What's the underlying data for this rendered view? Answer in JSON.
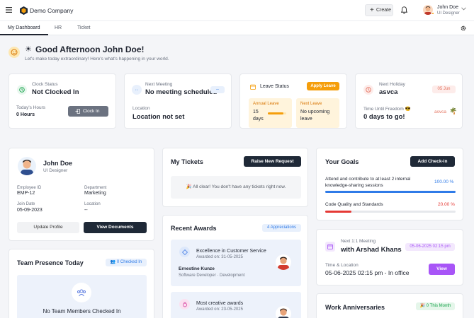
{
  "header": {
    "company_name": "Demo Company",
    "create_label": "Create",
    "user_name": "John Doe",
    "user_role": "UI Designer"
  },
  "tabs": [
    "My Dashboard",
    "HR",
    "Ticket"
  ],
  "greeting": {
    "title": "Good Afternoon John Doe!",
    "subtitle": "Let's make today extraordinary! Here's what's happening in your world."
  },
  "clock": {
    "label": "Clock Status",
    "status": "Not Clocked In",
    "hours_label": "Today's Hours",
    "hours_value": "0 Hours",
    "button": "Clock In"
  },
  "meeting": {
    "label": "Next Meeting",
    "value": "No meeting scheduled",
    "badge": "--",
    "location_label": "Location",
    "location_value": "Location not set"
  },
  "leave": {
    "title": "Leave Status",
    "button": "Apply Leave",
    "annual_label": "Annual Leave",
    "annual_value": "15 days",
    "annual_progress": 0.85,
    "next_label": "Next Leave",
    "next_value": "No upcoming leave"
  },
  "holiday": {
    "label": "Next Holiday",
    "name": "asvca",
    "date": "05 Jun",
    "freedom_label": "Time Until Freedom 😎",
    "freedom_value": "0 days to go!",
    "tag": "asvca"
  },
  "profile": {
    "name": "John Doe",
    "role": "UI Designer",
    "employee_id_label": "Employee ID",
    "employee_id": "EMP-12",
    "department_label": "Department",
    "department": "Marketing",
    "join_label": "Join Date",
    "join_date": "05-09-2023",
    "location_label": "Location",
    "location": "--",
    "update_button": "Update Profile",
    "documents_button": "View Documents"
  },
  "presence": {
    "title": "Team Presence Today",
    "badge": "0 Checked In",
    "empty": "No Team Members Checked In"
  },
  "tickets": {
    "title": "My Tickets",
    "button": "Raise New Request",
    "empty": "All clear! You don't have any tickets right now."
  },
  "awards": {
    "title": "Recent Awards",
    "badge": "4 Appreciations",
    "items": [
      {
        "title": "Excellence in Customer Service",
        "date": "Awarded on: 31-05-2025",
        "person": "Ernestine Kunze",
        "person_role": "Software Developer · Development"
      },
      {
        "title": "Most creative awards",
        "date": "Awarded on: 23-05-2025"
      }
    ]
  },
  "goals": {
    "title": "Your Goals",
    "button": "Add Check-in",
    "items": [
      {
        "text": "Attend and contribute to at least 2 internal knowledge-sharing sessions",
        "percent_label": "100.00 %",
        "progress": 1.0,
        "color": "#2f7be8"
      },
      {
        "text": "Code Quality and Standards",
        "percent_label": "20.00 %",
        "progress": 0.2,
        "color": "#e53935"
      }
    ]
  },
  "one_on_one": {
    "label": "Next 1:1 Meeting",
    "with": "with Arshad Khans",
    "date_badge": "05-06-2025 02:15 pm",
    "time_label": "Time & Location",
    "time_value": "05-06-2025 02:15 pm - In office",
    "button": "View"
  },
  "anniversaries": {
    "title": "Work Anniversaries",
    "badge": "0 This Month"
  },
  "colors": {
    "primary_dark": "#1f2937",
    "accent_orange": "#f59e0b",
    "accent_purple": "#a855f7",
    "accent_blue": "#2f7be8",
    "accent_red": "#e53935",
    "accent_green": "#16a34a"
  }
}
